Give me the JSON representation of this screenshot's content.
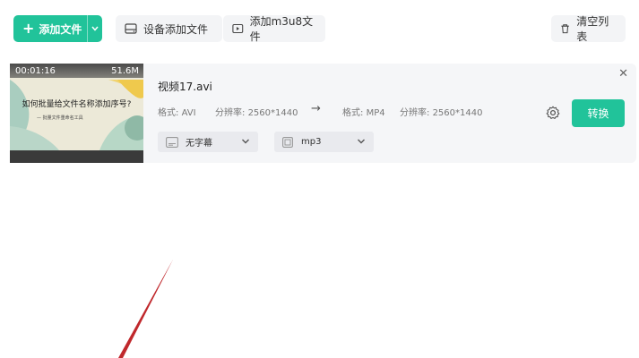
{
  "toolbar": {
    "add_file_label": "添加文件",
    "device_add_label": "设备添加文件",
    "add_m3u8_label": "添加m3u8文件",
    "clear_list_label": "清空列表"
  },
  "file": {
    "thumb_time": "00:01:16",
    "thumb_size": "51.6M",
    "thumb_title": "如何批量给文件名称添加序号?",
    "thumb_subtitle": "— 批量文件重命名工具",
    "name": "视频17.avi",
    "source_format_label": "格式:",
    "source_format": "AVI",
    "source_resolution_label": "分辨率:",
    "source_resolution": "2560*1440",
    "target_format_label": "格式:",
    "target_format": "MP4",
    "target_resolution_label": "分辨率:",
    "target_resolution": "2560*1440",
    "subtitle_option": "无字幕",
    "audio_option": "mp3",
    "convert_label": "转换"
  },
  "colors": {
    "accent": "#21c39a",
    "annotation": "#c0282c"
  }
}
